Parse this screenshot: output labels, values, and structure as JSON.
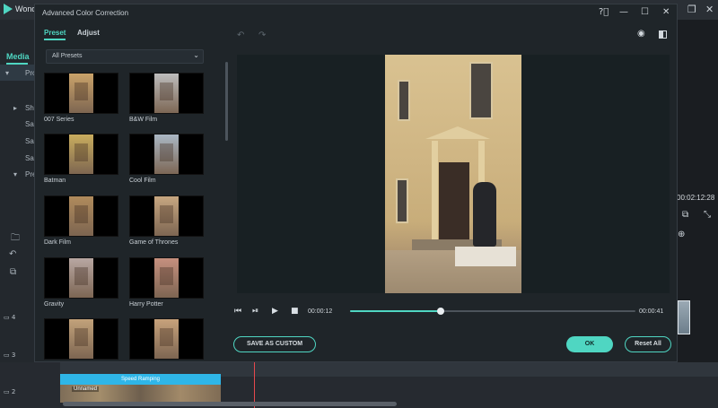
{
  "background_app": {
    "title": "Wond",
    "media_tab": "Media",
    "tree_items": [
      "Pro",
      "Sh",
      "Sa",
      "Sa",
      "Sa",
      "Pre"
    ],
    "right_time": "00:02:12:28",
    "track_labels": [
      "4",
      "3",
      "2"
    ],
    "speed_ramping_label": "Speed Ramping",
    "clip_label": "Unnamed"
  },
  "dialog": {
    "title": "Advanced Color Correction",
    "tabs": {
      "preset": "Preset",
      "adjust": "Adjust"
    },
    "dropdown_value": "All Presets",
    "presets": [
      {
        "label": "007 Series",
        "tint": "#caa36a"
      },
      {
        "label": "B&W Film",
        "tint": "#bdbdbd"
      },
      {
        "label": "Batman",
        "tint": "#c9ad5e"
      },
      {
        "label": "Cool Film",
        "tint": "#aab7c4"
      },
      {
        "label": "Dark Film",
        "tint": "#b08b5c"
      },
      {
        "label": "Game of Thrones",
        "tint": "#c7a781"
      },
      {
        "label": "Gravity",
        "tint": "#b8a7a2"
      },
      {
        "label": "Harry Potter",
        "tint": "#c6907f"
      },
      {
        "label": "",
        "tint": "#c2a27a"
      },
      {
        "label": "",
        "tint": "#c7a27b"
      }
    ],
    "playback": {
      "current_time": "00:00:12",
      "total_time": "00:00:41",
      "progress": 0.317
    },
    "buttons": {
      "save_custom": "SAVE AS CUSTOM",
      "ok": "OK",
      "reset_all": "Reset All"
    }
  },
  "colors": {
    "accent": "#4fd6c2",
    "dialog_bg": "#1f2529",
    "preview_bg": "#182023"
  }
}
